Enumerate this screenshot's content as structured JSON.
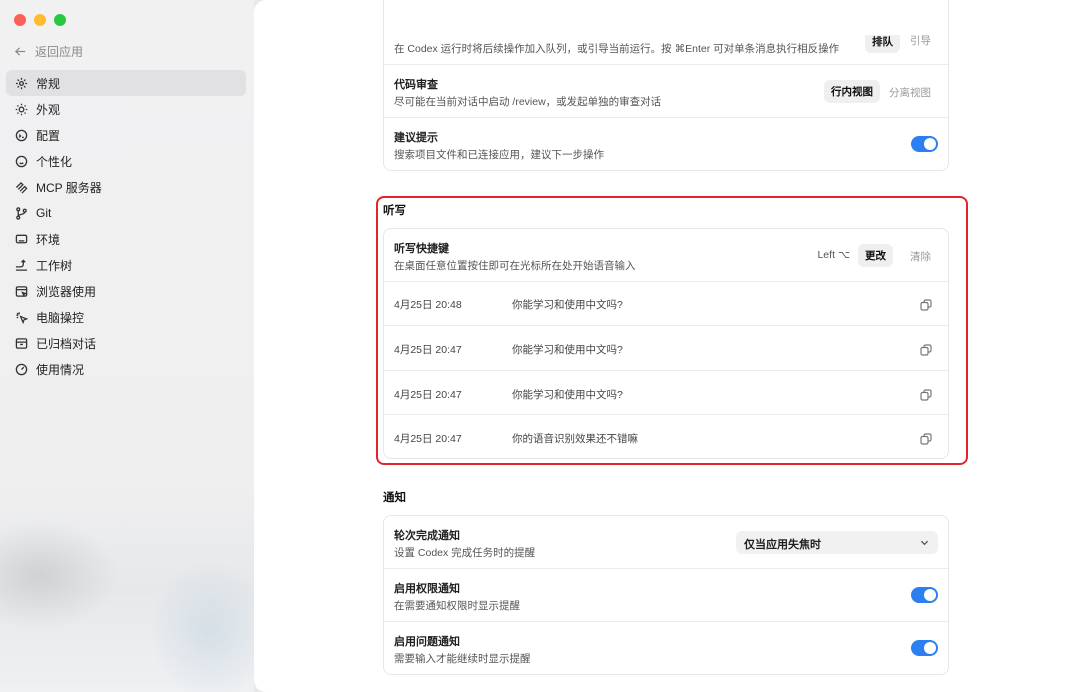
{
  "sidebar": {
    "back_label": "返回应用",
    "items": [
      {
        "label": "常规",
        "icon": "gear-icon",
        "active": true
      },
      {
        "label": "外观",
        "icon": "sun-icon"
      },
      {
        "label": "配置",
        "icon": "config-icon"
      },
      {
        "label": "个性化",
        "icon": "personalize-icon"
      },
      {
        "label": "MCP 服务器",
        "icon": "mcp-icon"
      },
      {
        "label": "Git",
        "icon": "git-branch-icon"
      },
      {
        "label": "环境",
        "icon": "monitor-icon"
      },
      {
        "label": "工作树",
        "icon": "worktree-icon"
      },
      {
        "label": "浏览器使用",
        "icon": "browser-icon"
      },
      {
        "label": "电脑操控",
        "icon": "pointer-icon"
      },
      {
        "label": "已归档对话",
        "icon": "archive-icon"
      },
      {
        "label": "使用情况",
        "icon": "gauge-icon"
      }
    ]
  },
  "top_card": {
    "queue_desc": "在 Codex 运行时将后续操作加入队列，或引导当前运行。按 ⌘Enter 可对单条消息执行相反操作",
    "queue_opt1": "排队",
    "queue_opt2": "引导",
    "review_title": "代码审查",
    "review_desc": "尽可能在当前对话中启动 /review，或发起单独的审查对话",
    "review_opt1": "行内视图",
    "review_opt2": "分离视图",
    "suggest_title": "建议提示",
    "suggest_desc": "搜索项目文件和已连接应用，建议下一步操作"
  },
  "dictation": {
    "section_title": "听写",
    "shortcut_title": "听写快捷键",
    "shortcut_desc": "在桌面任意位置按住即可在光标所在处开始语音输入",
    "shortcut_key": "Left ⌥",
    "change_label": "更改",
    "clear_label": "清除",
    "history": [
      {
        "date": "4月25日 20:48",
        "text": "你能学习和使用中文吗?"
      },
      {
        "date": "4月25日 20:47",
        "text": "你能学习和使用中文吗?"
      },
      {
        "date": "4月25日 20:47",
        "text": "你能学习和使用中文吗?"
      },
      {
        "date": "4月25日 20:47",
        "text": "你的语音识别效果还不错嘛"
      }
    ]
  },
  "notifications": {
    "section_title": "通知",
    "turn_title": "轮次完成通知",
    "turn_desc": "设置 Codex 完成任务时的提醒",
    "turn_value": "仅当应用失焦时",
    "perm_title": "启用权限通知",
    "perm_desc": "在需要通知权限时显示提醒",
    "issue_title": "启用问题通知",
    "issue_desc": "需要输入才能继续时显示提醒"
  },
  "colors": {
    "accent": "#2b7ff0",
    "highlight": "#e0262c"
  }
}
